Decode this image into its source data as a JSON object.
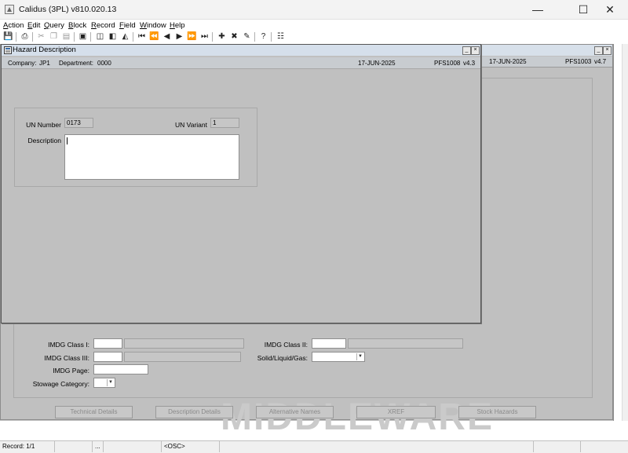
{
  "window": {
    "title": "Calidus (3PL) v810.020.13"
  },
  "menu": [
    {
      "label": "Action",
      "key": "A",
      "rest": "ction"
    },
    {
      "label": "Edit",
      "key": "E",
      "rest": "dit"
    },
    {
      "label": "Query",
      "key": "Q",
      "rest": "uery"
    },
    {
      "label": "Block",
      "key": "B",
      "rest": "lock"
    },
    {
      "label": "Record",
      "key": "R",
      "rest": "ecord"
    },
    {
      "label": "Field",
      "key": "F",
      "rest": "ield"
    },
    {
      "label": "Window",
      "key": "W",
      "rest": "indow"
    },
    {
      "label": "Help",
      "key": "H",
      "rest": "elp"
    }
  ],
  "toolbar_icons": [
    "save-icon",
    "print-icon",
    "cut-icon",
    "copy-icon",
    "paste-icon",
    "clear-icon",
    "enter-query-icon",
    "execute-query-icon",
    "cancel-query-icon",
    "first-record-icon",
    "previous-block-icon",
    "previous-record-icon",
    "next-record-icon",
    "next-block-icon",
    "last-record-icon",
    "insert-record-icon",
    "delete-record-icon",
    "lock-record-icon",
    "help-icon",
    "show-keys-icon"
  ],
  "back_window": {
    "date": "17-JUN-2025",
    "form_code": "PFS1003",
    "version": "v4.7",
    "watermark": "MIDDLEWARE",
    "labels": {
      "imdg_class_1": "IMDG Class I:",
      "imdg_class_2": "IMDG Class II:",
      "imdg_class_3": "IMDG Class III:",
      "solid_liquid_gas": "Solid/Liquid/Gas:",
      "imdg_page": "IMDG Page:",
      "stowage_category": "Stowage Category:"
    },
    "buttons": {
      "technical_details": "Technical Details",
      "description_details": "Description Details",
      "alternative_names": "Alternative Names",
      "xref": "XREF",
      "stock_hazards": "Stock Hazards"
    }
  },
  "front_window": {
    "title": "Hazard Description",
    "company_label": "Company:",
    "company_value": "JP1",
    "department_label": "Department:",
    "department_value": "0000",
    "date": "17-JUN-2025",
    "form_code": "PFS1008",
    "version": "v4.3",
    "un_number_label": "UN Number",
    "un_number_value": "0173",
    "un_variant_label": "UN Variant",
    "un_variant_value": "1",
    "description_label": "Description",
    "description_value": ""
  },
  "status_bar": {
    "record": "Record: 1/1",
    "ellipsis": "...",
    "osc": "<OSC>"
  },
  "colors": {
    "form_background": "#c0c0c0",
    "title_bar": "#d5dfeb",
    "field_background": "#ffffff",
    "readonly_field": "#c6c6c6"
  }
}
